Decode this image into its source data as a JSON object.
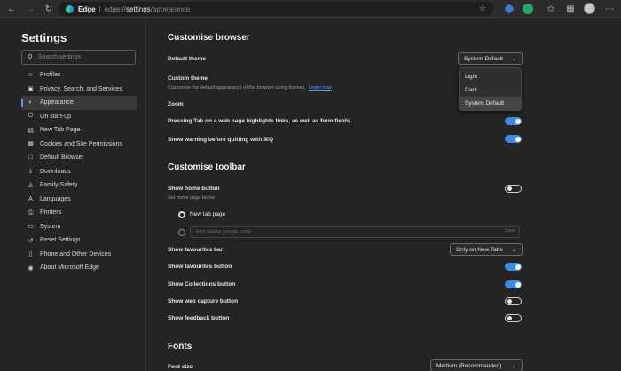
{
  "browser": {
    "brand": "Edge",
    "separator": "|",
    "url_scheme": "edge://",
    "url_host": "settings",
    "url_path": "/appearance"
  },
  "sidebar": {
    "title": "Settings",
    "search_placeholder": "Search settings",
    "items": [
      {
        "label": "Profiles",
        "icon": "profile-icon",
        "glyph": "☺"
      },
      {
        "label": "Privacy, Search, and Services",
        "icon": "lock-icon",
        "glyph": "▣"
      },
      {
        "label": "Appearance",
        "icon": "appearance-icon",
        "glyph": "◐",
        "active": true
      },
      {
        "label": "On start-up",
        "icon": "power-icon",
        "glyph": "⏻"
      },
      {
        "label": "New Tab Page",
        "icon": "new-tab-icon",
        "glyph": "▤"
      },
      {
        "label": "Cookies and Site Permissions",
        "icon": "cookies-icon",
        "glyph": "▦"
      },
      {
        "label": "Default Browser",
        "icon": "browser-icon",
        "glyph": "□"
      },
      {
        "label": "Downloads",
        "icon": "download-icon",
        "glyph": "⤓"
      },
      {
        "label": "Family Safety",
        "icon": "family-icon",
        "glyph": "♙"
      },
      {
        "label": "Languages",
        "icon": "language-icon",
        "glyph": "A"
      },
      {
        "label": "Printers",
        "icon": "printer-icon",
        "glyph": "⎙"
      },
      {
        "label": "System",
        "icon": "system-icon",
        "glyph": "▭"
      },
      {
        "label": "Reset Settings",
        "icon": "reset-icon",
        "glyph": "↺"
      },
      {
        "label": "Phone and Other Devices",
        "icon": "phone-icon",
        "glyph": "▯"
      },
      {
        "label": "About Microsoft Edge",
        "icon": "edge-logo-icon",
        "glyph": "◉"
      }
    ]
  },
  "customise_browser": {
    "heading": "Customise browser",
    "default_theme_label": "Default theme",
    "default_theme_value": "System Default",
    "theme_options": [
      "Light",
      "Dark",
      "System Default"
    ],
    "custom_theme_label": "Custom theme",
    "custom_theme_sub": "Customise the default appearance of the browser using themes.",
    "learn_how": "Learn how",
    "zoom_label": "Zoom",
    "tab_highlight_label": "Pressing Tab on a web page highlights links, as well as form fields",
    "tab_highlight_on": true,
    "quit_warning_label": "Show warning before quitting with ⌘Q",
    "quit_warning_on": true
  },
  "customise_toolbar": {
    "heading": "Customise toolbar",
    "home_button_label": "Show home button",
    "home_button_sub": "Set home page below",
    "home_button_on": false,
    "new_tab_option": "New tab page",
    "url_placeholder": "http://www.google.com/",
    "save_label": "Save",
    "favourites_bar_label": "Show favourites bar",
    "favourites_bar_value": "Only on New Tabs",
    "favourites_button_label": "Show favourites button",
    "favourites_button_on": true,
    "collections_button_label": "Show Collections button",
    "collections_button_on": true,
    "web_capture_label": "Show web capture button",
    "web_capture_on": false,
    "feedback_button_label": "Show feedback button",
    "feedback_button_on": false
  },
  "fonts": {
    "heading": "Fonts",
    "font_size_label": "Font size",
    "font_size_value": "Medium (Recommended)"
  },
  "colors": {
    "accent": "#3f8ae0",
    "link": "#4aa3ff",
    "background": "#242424"
  }
}
